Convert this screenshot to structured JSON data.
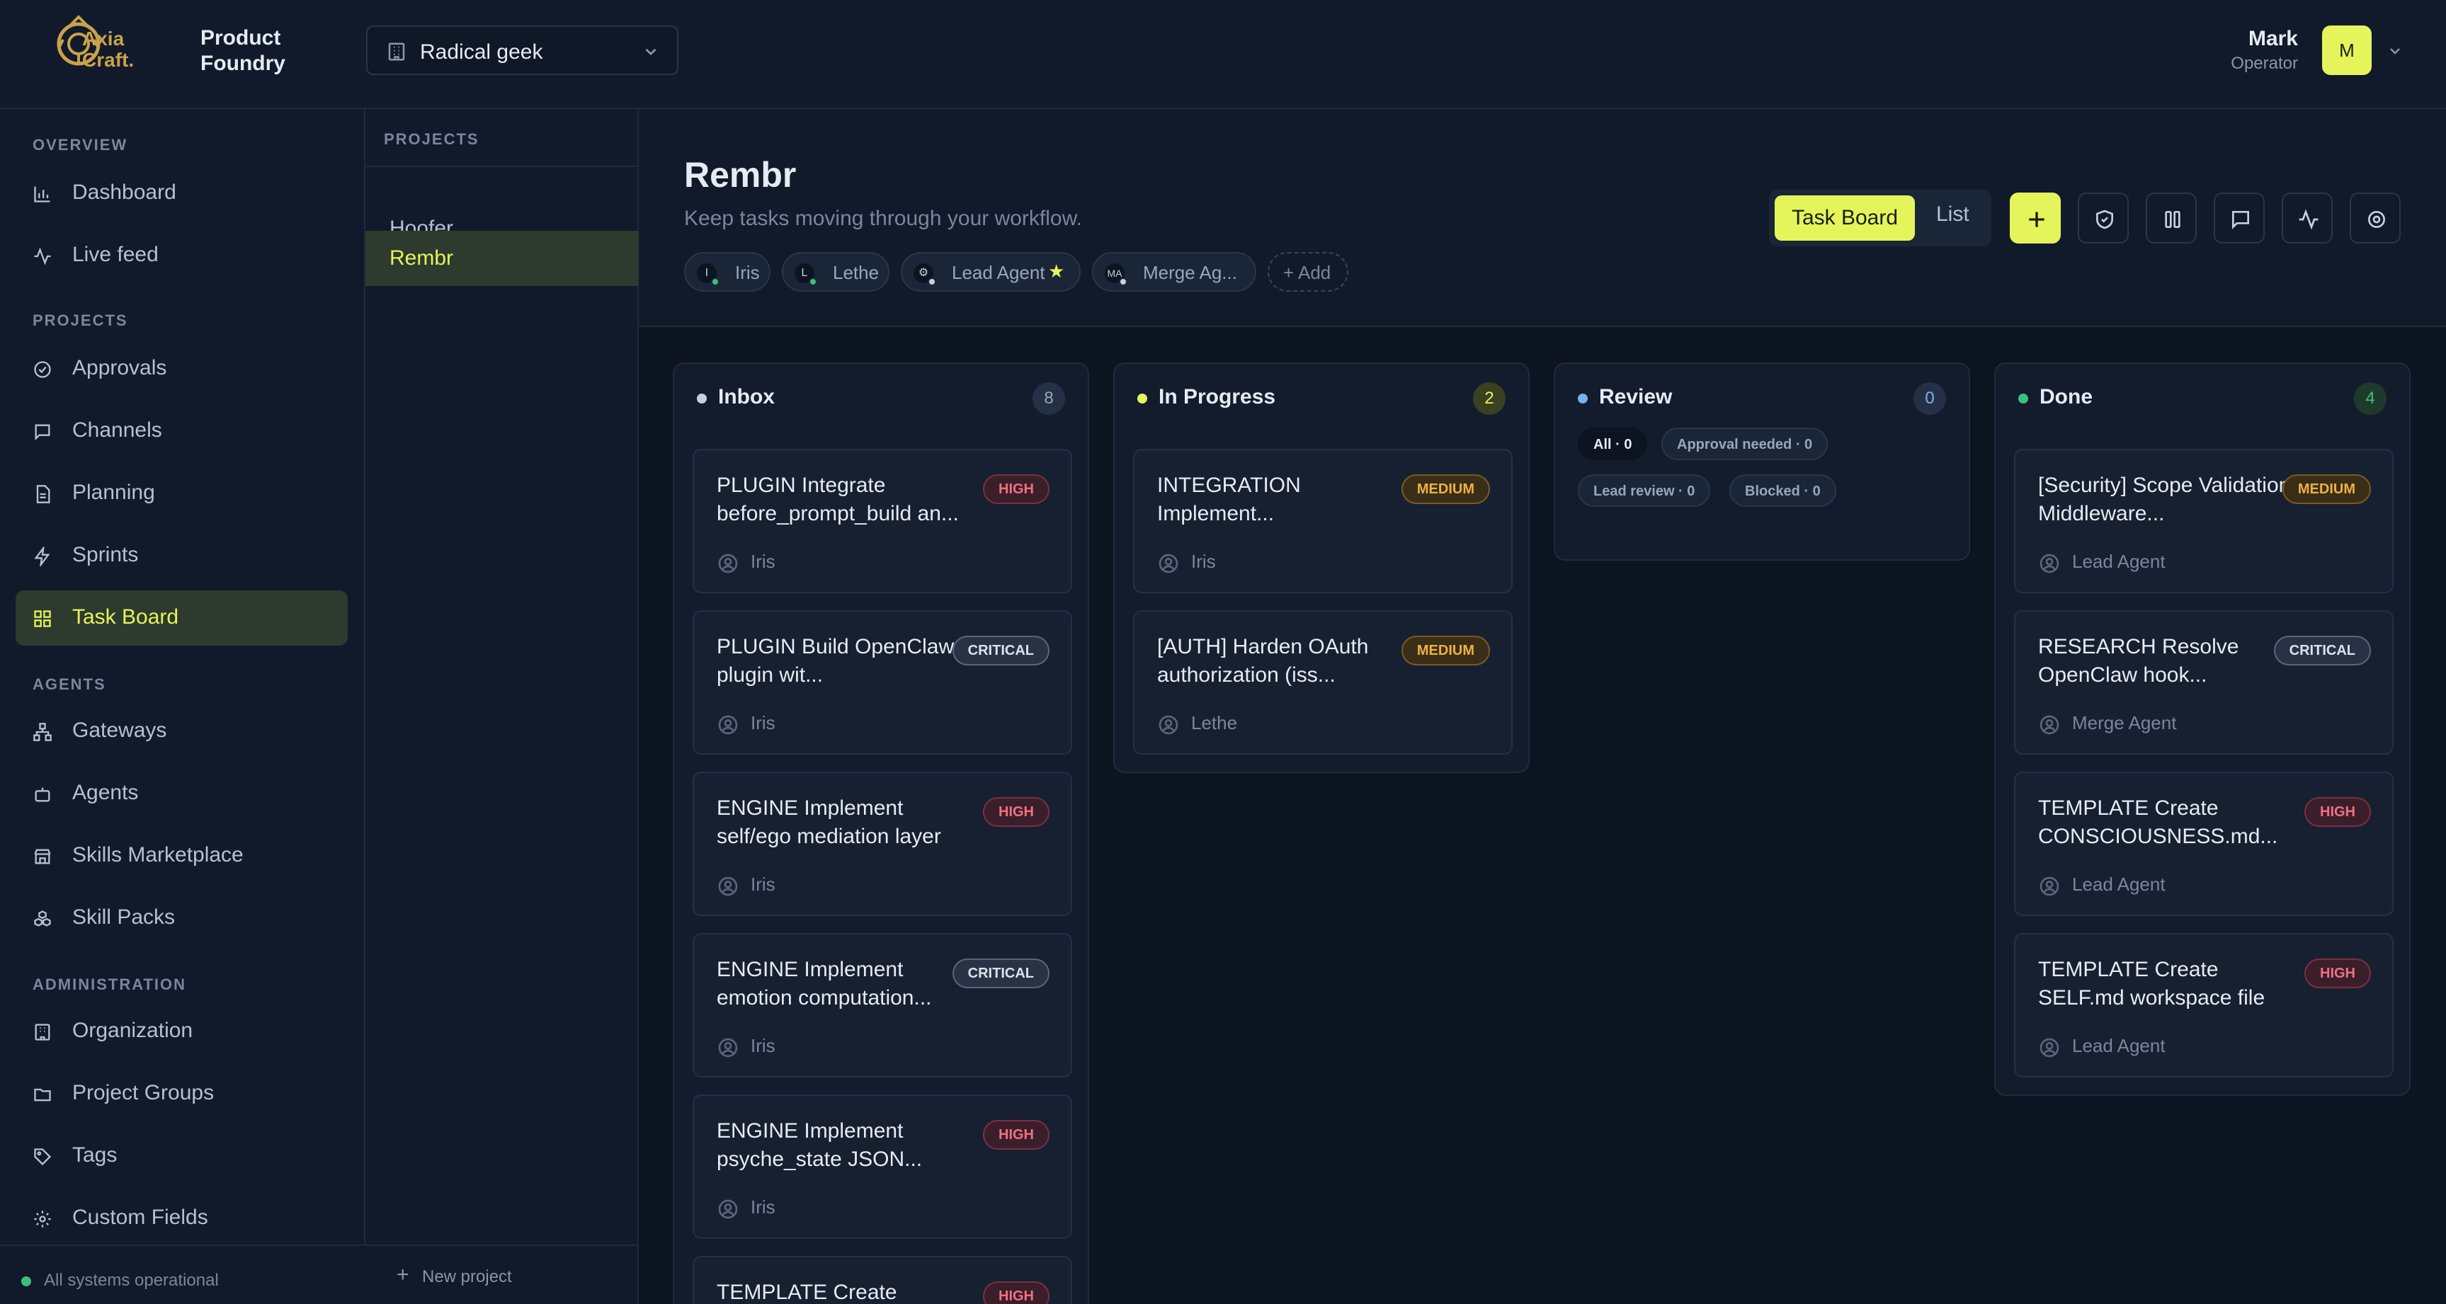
{
  "header": {
    "logo_text": "Axia Craft.",
    "brand": "Product Foundry",
    "org": "Radical geek",
    "user_name": "Mark",
    "user_role": "Operator",
    "avatar_initial": "M"
  },
  "sidebar": {
    "overview_label": "OVERVIEW",
    "projects_label": "PROJECTS",
    "agents_label": "AGENTS",
    "admin_label": "ADMINISTRATION",
    "items": {
      "dashboard": "Dashboard",
      "live_feed": "Live feed",
      "approvals": "Approvals",
      "channels": "Channels",
      "planning": "Planning",
      "sprints": "Sprints",
      "task_board": "Task Board",
      "gateways": "Gateways",
      "agents": "Agents",
      "skills_marketplace": "Skills Marketplace",
      "skill_packs": "Skill Packs",
      "organization": "Organization",
      "project_groups": "Project Groups",
      "tags": "Tags",
      "custom_fields": "Custom Fields"
    },
    "status": "All systems operational"
  },
  "projects_panel": {
    "heading": "PROJECTS",
    "items": [
      "Hoofer",
      "Rembr"
    ],
    "new_project": "New project"
  },
  "board": {
    "title": "Rembr",
    "subtitle": "Keep tasks moving through your workflow.",
    "agents": [
      {
        "initial": "I",
        "name": "Iris"
      },
      {
        "initial": "L",
        "name": "Lethe"
      },
      {
        "initial": "",
        "name": "Lead Agent"
      },
      {
        "initial": "MA",
        "name": "Merge Ag..."
      }
    ],
    "add_label": "+ Add",
    "view_task_board": "Task Board",
    "view_list": "List"
  },
  "columns": {
    "inbox": {
      "name": "Inbox",
      "count": "8",
      "cards": [
        {
          "title": "PLUGIN Integrate before_prompt_build an...",
          "priority": "HIGH",
          "assignee": "Iris"
        },
        {
          "title": "PLUGIN Build OpenClaw plugin wit...",
          "priority": "CRITICAL",
          "assignee": "Iris"
        },
        {
          "title": "ENGINE Implement self/ego mediation layer",
          "priority": "HIGH",
          "assignee": "Iris"
        },
        {
          "title": "ENGINE Implement emotion computation...",
          "priority": "CRITICAL",
          "assignee": "Iris"
        },
        {
          "title": "ENGINE Implement psyche_state JSON...",
          "priority": "HIGH",
          "assignee": "Iris"
        },
        {
          "title": "TEMPLATE Create",
          "priority": "HIGH",
          "assignee": ""
        }
      ]
    },
    "in_progress": {
      "name": "In Progress",
      "count": "2",
      "cards": [
        {
          "title": "INTEGRATION Implement...",
          "priority": "MEDIUM",
          "assignee": "Iris"
        },
        {
          "title": "[AUTH] Harden OAuth authorization (iss...",
          "priority": "MEDIUM",
          "assignee": "Lethe"
        }
      ]
    },
    "review": {
      "name": "Review",
      "count": "0",
      "filters": [
        "All · 0",
        "Approval needed · 0",
        "Lead review · 0",
        "Blocked · 0"
      ]
    },
    "done": {
      "name": "Done",
      "count": "4",
      "cards": [
        {
          "title": "[Security] Scope Validation Middleware...",
          "priority": "MEDIUM",
          "assignee": "Lead Agent"
        },
        {
          "title": "RESEARCH Resolve OpenClaw hook...",
          "priority": "CRITICAL",
          "assignee": "Merge Agent"
        },
        {
          "title": "TEMPLATE Create CONSCIOUSNESS.md...",
          "priority": "HIGH",
          "assignee": "Lead Agent"
        },
        {
          "title": "TEMPLATE Create SELF.md workspace file",
          "priority": "HIGH",
          "assignee": "Lead Agent"
        }
      ]
    }
  },
  "colors": {
    "accent": "#e4f45a",
    "background": "#0c1321",
    "panel": "#111a2b",
    "high": "#f07080",
    "medium": "#f0b040",
    "online": "#3cc07a"
  }
}
